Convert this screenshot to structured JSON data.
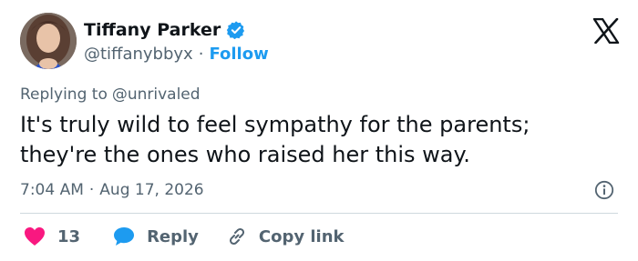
{
  "author": {
    "display_name": "Tiffany Parker",
    "handle": "@tiffanybbyx",
    "separator": "·",
    "follow_label": "Follow",
    "verified_icon": "verified-badge-icon"
  },
  "reply_context": {
    "prefix": "Replying to",
    "mention": "@unrivaled"
  },
  "tweet": {
    "text": "It's truly wild to feel sympathy for the parents; they're the ones who raised her this way.",
    "time": "7:04 AM",
    "separator": "·",
    "date": "Aug 17, 2026"
  },
  "actions": {
    "like_count": "13",
    "reply_label": "Reply",
    "copy_label": "Copy link"
  },
  "icons": {
    "brand": "x-logo-icon",
    "info": "info-icon",
    "like": "heart-icon",
    "reply": "speech-bubble-icon",
    "copy": "link-icon"
  },
  "colors": {
    "accent": "#1d9bf0",
    "like": "#f91880",
    "text": "#0f1419",
    "muted": "#536471",
    "divider": "#cfd9de"
  }
}
